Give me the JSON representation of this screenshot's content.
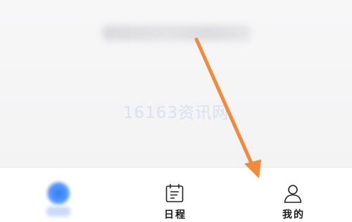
{
  "watermark": "16163资讯网",
  "tabs": {
    "schedule": {
      "label": "日程",
      "icon": "calendar-icon"
    },
    "mine": {
      "label": "我的",
      "icon": "person-icon"
    },
    "home": {
      "icon": "home-icon"
    }
  },
  "colors": {
    "accent": "#2f7cf6",
    "arrow": "#f08a3c",
    "tab_bar": "#ffffff",
    "background": "#f5f5f6"
  }
}
